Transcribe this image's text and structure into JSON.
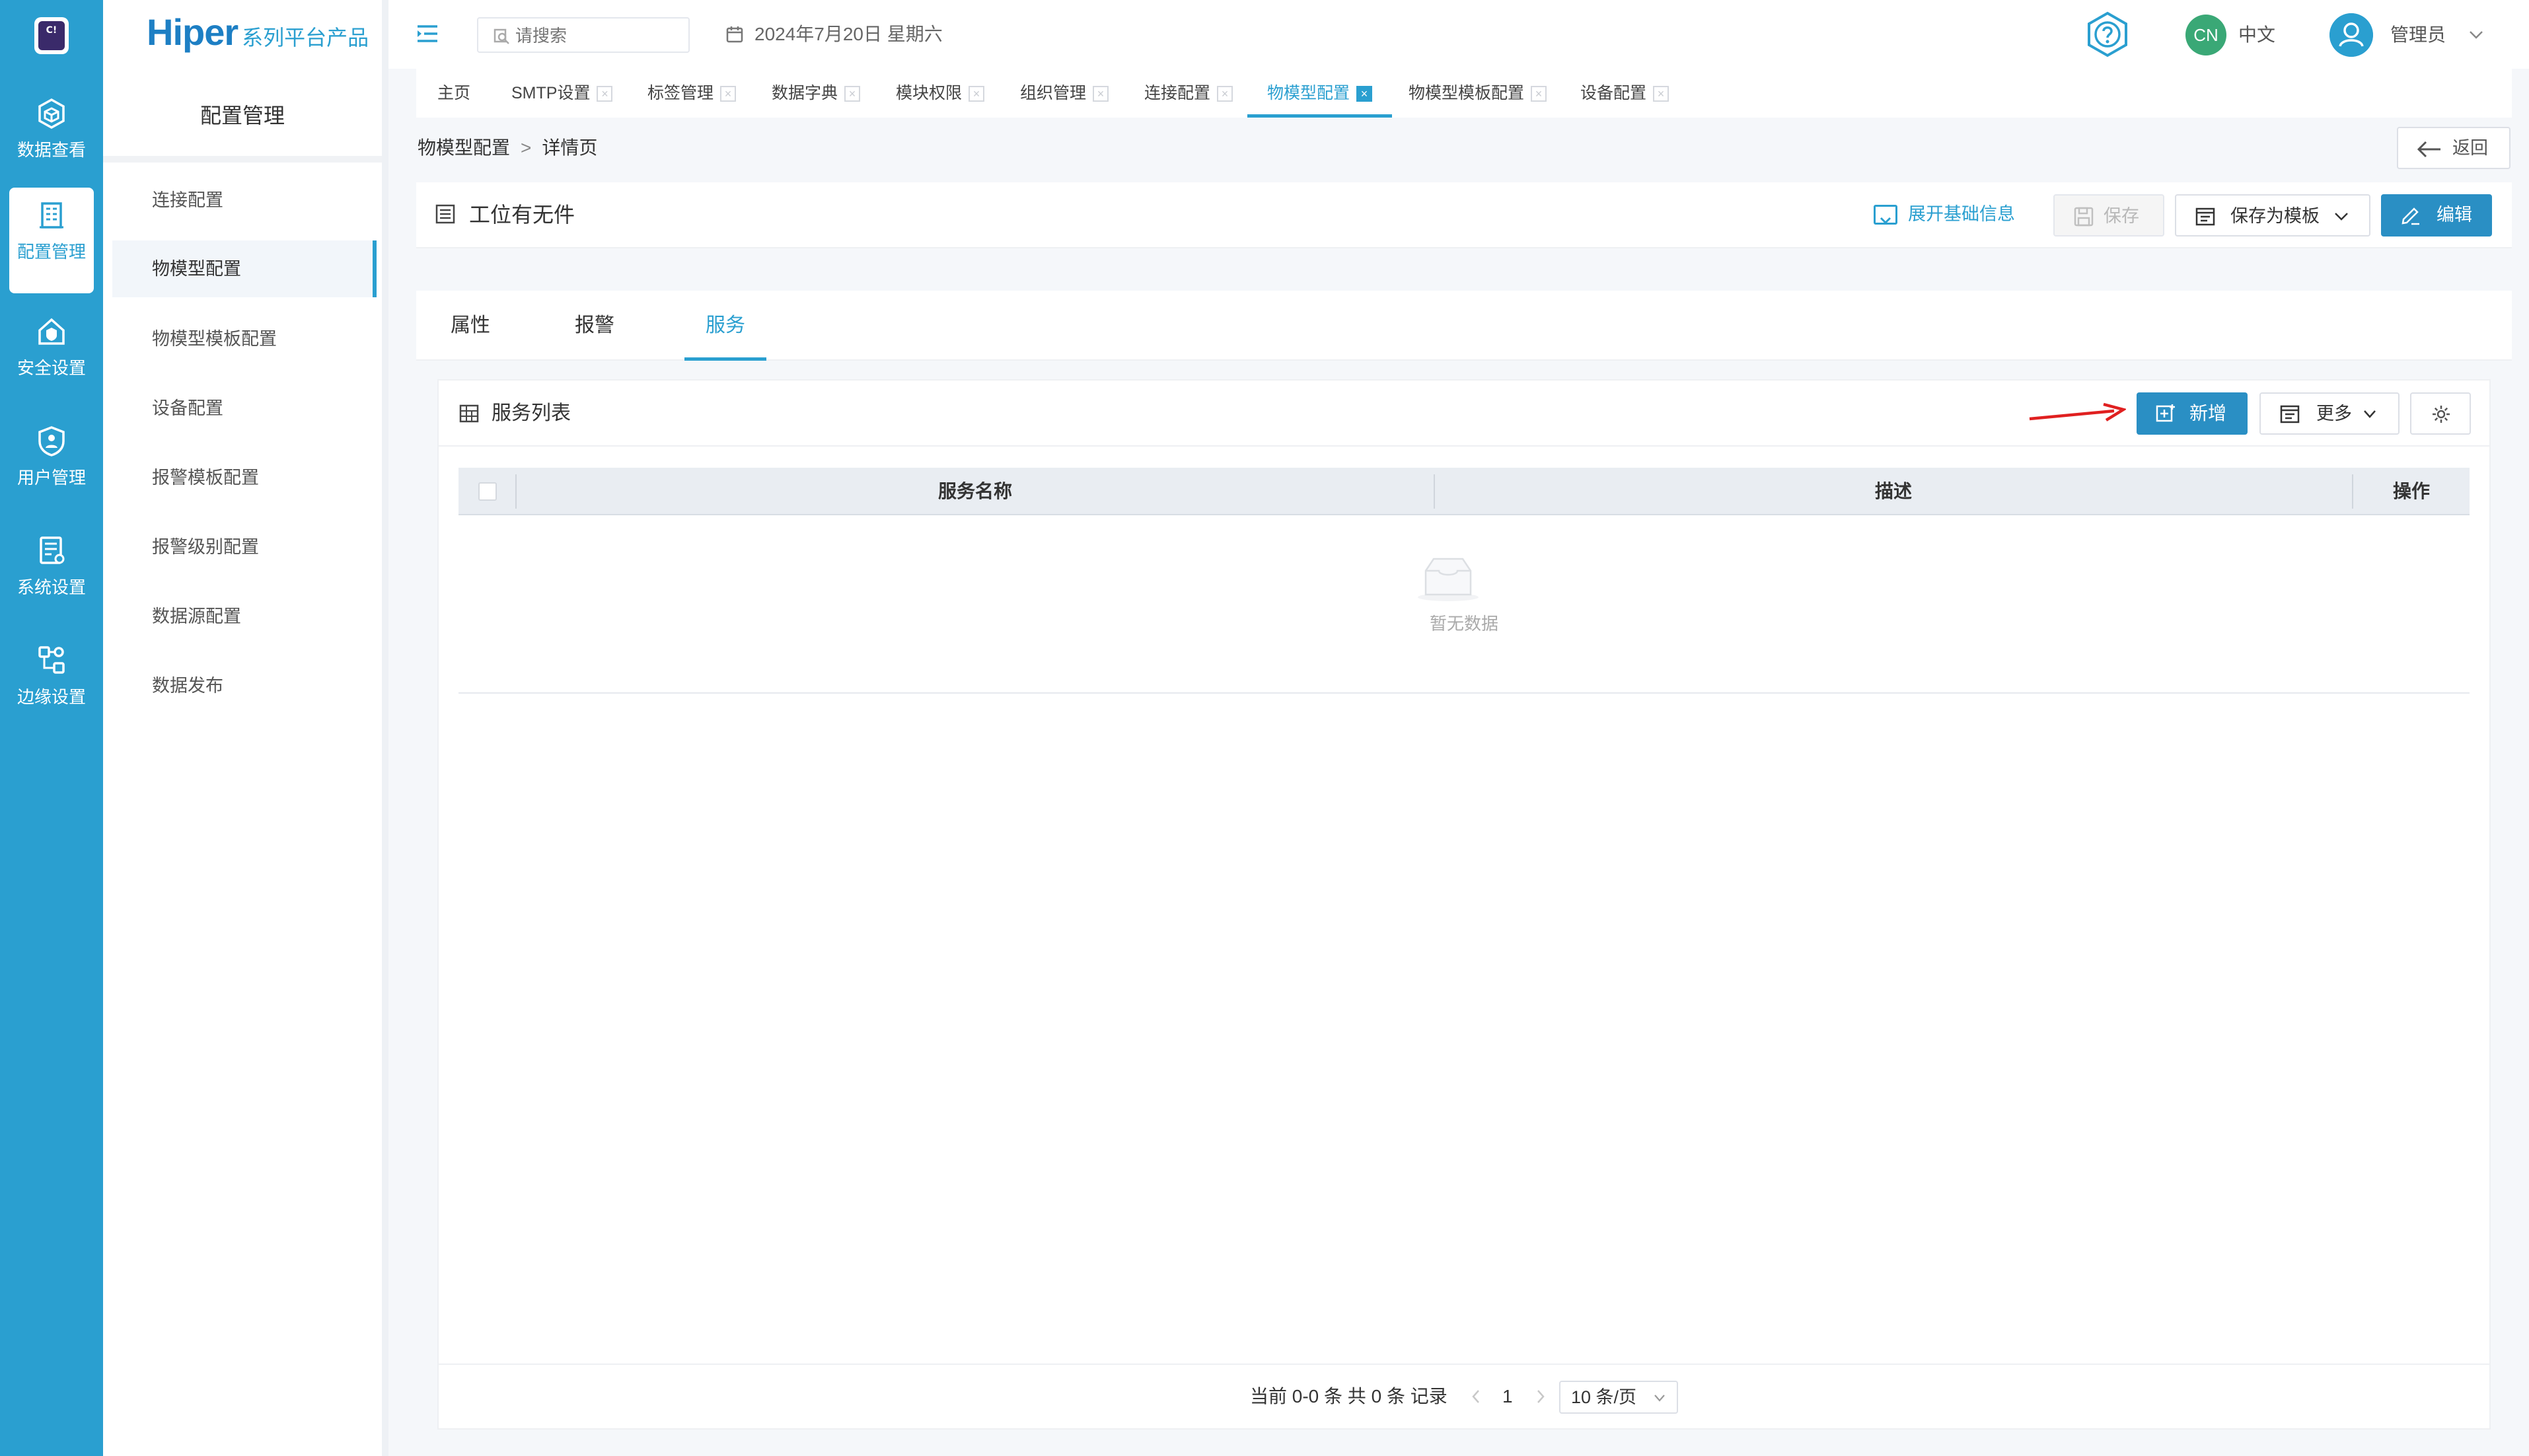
{
  "rail": {
    "logo_text": "C!",
    "items": [
      {
        "label": "数据查看",
        "icon": "cube-icon"
      },
      {
        "label": "配置管理",
        "icon": "building-icon",
        "active": true
      },
      {
        "label": "安全设置",
        "icon": "home-shield-icon"
      },
      {
        "label": "用户管理",
        "icon": "user-shield-icon"
      },
      {
        "label": "系统设置",
        "icon": "server-settings-icon"
      },
      {
        "label": "边缘设置",
        "icon": "edge-nodes-icon"
      }
    ]
  },
  "brand": {
    "name": "Hiper",
    "suffix": "系列平台产品"
  },
  "sidebar": {
    "title": "配置管理",
    "items": [
      {
        "label": "连接配置"
      },
      {
        "label": "物模型配置",
        "active": true
      },
      {
        "label": "物模型模板配置"
      },
      {
        "label": "设备配置"
      },
      {
        "label": "报警模板配置"
      },
      {
        "label": "报警级别配置"
      },
      {
        "label": "数据源配置"
      },
      {
        "label": "数据发布"
      }
    ]
  },
  "header": {
    "search_placeholder": "请搜索",
    "date": "2024年7月20日 星期六",
    "lang_badge": "CN",
    "lang": "中文",
    "user": "管理员"
  },
  "tabs": [
    {
      "label": "主页",
      "closable": false
    },
    {
      "label": "SMTP设置",
      "closable": true
    },
    {
      "label": "标签管理",
      "closable": true
    },
    {
      "label": "数据字典",
      "closable": true
    },
    {
      "label": "模块权限",
      "closable": true
    },
    {
      "label": "组织管理",
      "closable": true
    },
    {
      "label": "连接配置",
      "closable": true
    },
    {
      "label": "物模型配置",
      "closable": true,
      "active": true
    },
    {
      "label": "物模型模板配置",
      "closable": true
    },
    {
      "label": "设备配置",
      "closable": true
    }
  ],
  "breadcrumb": {
    "parent": "物模型配置",
    "sep": ">",
    "current": "详情页"
  },
  "back_label": "返回",
  "title_card": {
    "title": "工位有无件",
    "expand_label": "展开基础信息",
    "save_label": "保存",
    "save_template_label": "保存为模板",
    "edit_label": "编辑"
  },
  "sub_tabs": [
    {
      "label": "属性"
    },
    {
      "label": "报警"
    },
    {
      "label": "服务",
      "active": true
    }
  ],
  "service_panel": {
    "title": "服务列表",
    "add_label": "新增",
    "more_label": "更多",
    "columns": [
      "服务名称",
      "描述",
      "操作"
    ],
    "empty_text": "暂无数据"
  },
  "pagination": {
    "info": "当前 0-0 条 共 0 条 记录",
    "page": "1",
    "page_size": "10 条/页"
  },
  "colors": {
    "accent": "#2a9fd0",
    "primary_button": "#2a8fc4",
    "lang_badge": "#3aa876",
    "arrow": "#e02020"
  }
}
